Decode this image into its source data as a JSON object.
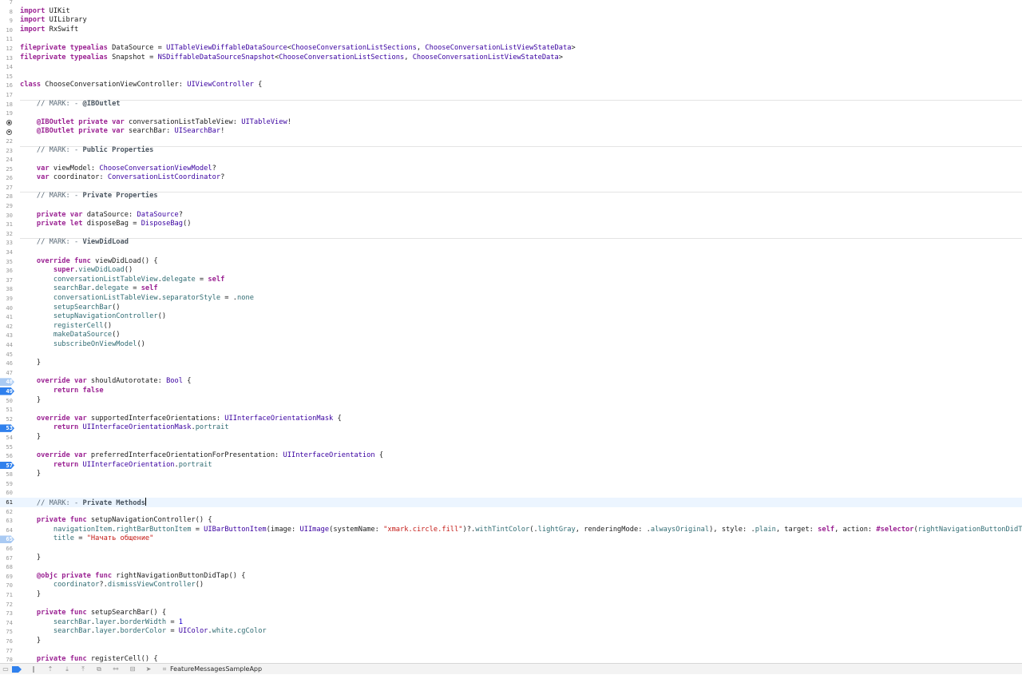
{
  "editor": {
    "current_line": 61,
    "lines": [
      {
        "n": 7,
        "t": []
      },
      {
        "n": 8,
        "t": [
          [
            "kw",
            "import"
          ],
          [
            "pl",
            " UIKit"
          ]
        ]
      },
      {
        "n": 9,
        "t": [
          [
            "kw",
            "import"
          ],
          [
            "pl",
            " UILibrary"
          ]
        ]
      },
      {
        "n": 10,
        "t": [
          [
            "kw",
            "import"
          ],
          [
            "pl",
            " RxSwift"
          ]
        ]
      },
      {
        "n": 11,
        "t": []
      },
      {
        "n": 12,
        "t": [
          [
            "kw",
            "fileprivate typealias"
          ],
          [
            "pl",
            " DataSource = "
          ],
          [
            "ty",
            "UITableViewDiffableDataSource"
          ],
          [
            "pl",
            "<"
          ],
          [
            "ty",
            "ChooseConversationListSections"
          ],
          [
            "pl",
            ", "
          ],
          [
            "ty",
            "ChooseConversationListViewStateData"
          ],
          [
            "pl",
            ">"
          ]
        ]
      },
      {
        "n": 13,
        "t": [
          [
            "kw",
            "fileprivate typealias"
          ],
          [
            "pl",
            " Snapshot = "
          ],
          [
            "ty",
            "NSDiffableDataSourceSnapshot"
          ],
          [
            "pl",
            "<"
          ],
          [
            "ty",
            "ChooseConversationListSections"
          ],
          [
            "pl",
            ", "
          ],
          [
            "ty",
            "ChooseConversationListViewStateData"
          ],
          [
            "pl",
            ">"
          ]
        ]
      },
      {
        "n": 14,
        "t": []
      },
      {
        "n": 15,
        "t": []
      },
      {
        "n": 16,
        "t": [
          [
            "kw",
            "class"
          ],
          [
            "pl",
            " ChooseConversationViewController: "
          ],
          [
            "ty",
            "UIViewController"
          ],
          [
            "pl",
            " {"
          ]
        ]
      },
      {
        "n": 17,
        "t": []
      },
      {
        "n": 18,
        "mark": true,
        "t": [
          [
            "pl",
            "    "
          ],
          [
            "cm",
            "// MARK: - "
          ],
          [
            "cmb",
            "@IBOutlet"
          ]
        ]
      },
      {
        "n": 19,
        "t": []
      },
      {
        "n": 20,
        "outlet": true,
        "t": [
          [
            "pl",
            "    "
          ],
          [
            "kw",
            "@IBOutlet private var"
          ],
          [
            "pl",
            " conversationListTableView: "
          ],
          [
            "ty",
            "UITableView"
          ],
          [
            "pl",
            "!"
          ]
        ]
      },
      {
        "n": 21,
        "outlet": true,
        "t": [
          [
            "pl",
            "    "
          ],
          [
            "kw",
            "@IBOutlet private var"
          ],
          [
            "pl",
            " searchBar: "
          ],
          [
            "ty",
            "UISearchBar"
          ],
          [
            "pl",
            "!"
          ]
        ]
      },
      {
        "n": 22,
        "t": []
      },
      {
        "n": 23,
        "mark": true,
        "t": [
          [
            "pl",
            "    "
          ],
          [
            "cm",
            "// MARK: - "
          ],
          [
            "cmb",
            "Public Properties"
          ]
        ]
      },
      {
        "n": 24,
        "t": []
      },
      {
        "n": 25,
        "t": [
          [
            "pl",
            "    "
          ],
          [
            "kw",
            "var"
          ],
          [
            "pl",
            " viewModel: "
          ],
          [
            "ty",
            "ChooseConversationViewModel"
          ],
          [
            "pl",
            "?"
          ]
        ]
      },
      {
        "n": 26,
        "t": [
          [
            "pl",
            "    "
          ],
          [
            "kw",
            "var"
          ],
          [
            "pl",
            " coordinator: "
          ],
          [
            "ty",
            "ConversationListCoordinator"
          ],
          [
            "pl",
            "?"
          ]
        ]
      },
      {
        "n": 27,
        "t": []
      },
      {
        "n": 28,
        "mark": true,
        "t": [
          [
            "pl",
            "    "
          ],
          [
            "cm",
            "// MARK: - "
          ],
          [
            "cmb",
            "Private Properties"
          ]
        ]
      },
      {
        "n": 29,
        "t": []
      },
      {
        "n": 30,
        "t": [
          [
            "pl",
            "    "
          ],
          [
            "kw",
            "private var"
          ],
          [
            "pl",
            " dataSource: "
          ],
          [
            "ty",
            "DataSource"
          ],
          [
            "pl",
            "?"
          ]
        ]
      },
      {
        "n": 31,
        "t": [
          [
            "pl",
            "    "
          ],
          [
            "kw",
            "private let"
          ],
          [
            "pl",
            " disposeBag = "
          ],
          [
            "ty",
            "DisposeBag"
          ],
          [
            "pl",
            "()"
          ]
        ]
      },
      {
        "n": 32,
        "t": []
      },
      {
        "n": 33,
        "mark": true,
        "t": [
          [
            "pl",
            "    "
          ],
          [
            "cm",
            "// MARK: - "
          ],
          [
            "cmb",
            "ViewDidLoad"
          ]
        ]
      },
      {
        "n": 34,
        "t": []
      },
      {
        "n": 35,
        "t": [
          [
            "pl",
            "    "
          ],
          [
            "kw",
            "override func"
          ],
          [
            "pl",
            " viewDidLoad() {"
          ]
        ]
      },
      {
        "n": 36,
        "t": [
          [
            "pl",
            "        "
          ],
          [
            "kw",
            "super"
          ],
          [
            "pl",
            "."
          ],
          [
            "fn",
            "viewDidLoad"
          ],
          [
            "pl",
            "()"
          ]
        ]
      },
      {
        "n": 37,
        "t": [
          [
            "pl",
            "        "
          ],
          [
            "fn",
            "conversationListTableView"
          ],
          [
            "pl",
            "."
          ],
          [
            "fn",
            "delegate"
          ],
          [
            "pl",
            " = "
          ],
          [
            "kw",
            "self"
          ]
        ]
      },
      {
        "n": 38,
        "t": [
          [
            "pl",
            "        "
          ],
          [
            "fn",
            "searchBar"
          ],
          [
            "pl",
            "."
          ],
          [
            "fn",
            "delegate"
          ],
          [
            "pl",
            " = "
          ],
          [
            "kw",
            "self"
          ]
        ]
      },
      {
        "n": 39,
        "t": [
          [
            "pl",
            "        "
          ],
          [
            "fn",
            "conversationListTableView"
          ],
          [
            "pl",
            "."
          ],
          [
            "fn",
            "separatorStyle"
          ],
          [
            "pl",
            " = ."
          ],
          [
            "fn",
            "none"
          ]
        ]
      },
      {
        "n": 40,
        "t": [
          [
            "pl",
            "        "
          ],
          [
            "fn",
            "setupSearchBar"
          ],
          [
            "pl",
            "()"
          ]
        ]
      },
      {
        "n": 41,
        "t": [
          [
            "pl",
            "        "
          ],
          [
            "fn",
            "setupNavigationController"
          ],
          [
            "pl",
            "()"
          ]
        ]
      },
      {
        "n": 42,
        "t": [
          [
            "pl",
            "        "
          ],
          [
            "fn",
            "registerCell"
          ],
          [
            "pl",
            "()"
          ]
        ]
      },
      {
        "n": 43,
        "t": [
          [
            "pl",
            "        "
          ],
          [
            "fn",
            "makeDataSource"
          ],
          [
            "pl",
            "()"
          ]
        ]
      },
      {
        "n": 44,
        "t": [
          [
            "pl",
            "        "
          ],
          [
            "fn",
            "subscribeOnViewModel"
          ],
          [
            "pl",
            "()"
          ]
        ]
      },
      {
        "n": 45,
        "t": []
      },
      {
        "n": 46,
        "t": [
          [
            "pl",
            "    }"
          ]
        ]
      },
      {
        "n": 47,
        "t": []
      },
      {
        "n": 48,
        "bp": "disabled",
        "t": [
          [
            "pl",
            "    "
          ],
          [
            "kw",
            "override var"
          ],
          [
            "pl",
            " shouldAutorotate: "
          ],
          [
            "ty",
            "Bool"
          ],
          [
            "pl",
            " {"
          ]
        ]
      },
      {
        "n": 49,
        "bp": "active",
        "t": [
          [
            "pl",
            "        "
          ],
          [
            "kw",
            "return false"
          ]
        ]
      },
      {
        "n": 50,
        "t": [
          [
            "pl",
            "    }"
          ]
        ]
      },
      {
        "n": 51,
        "t": []
      },
      {
        "n": 52,
        "t": [
          [
            "pl",
            "    "
          ],
          [
            "kw",
            "override var"
          ],
          [
            "pl",
            " supportedInterfaceOrientations: "
          ],
          [
            "ty",
            "UIInterfaceOrientationMask"
          ],
          [
            "pl",
            " {"
          ]
        ]
      },
      {
        "n": 53,
        "bp": "active",
        "t": [
          [
            "pl",
            "        "
          ],
          [
            "kw",
            "return"
          ],
          [
            "pl",
            " "
          ],
          [
            "ty",
            "UIInterfaceOrientationMask"
          ],
          [
            "pl",
            "."
          ],
          [
            "fn",
            "portrait"
          ]
        ]
      },
      {
        "n": 54,
        "t": [
          [
            "pl",
            "    }"
          ]
        ]
      },
      {
        "n": 55,
        "t": []
      },
      {
        "n": 56,
        "t": [
          [
            "pl",
            "    "
          ],
          [
            "kw",
            "override var"
          ],
          [
            "pl",
            " preferredInterfaceOrientationForPresentation: "
          ],
          [
            "ty",
            "UIInterfaceOrientation"
          ],
          [
            "pl",
            " {"
          ]
        ]
      },
      {
        "n": 57,
        "bp": "active",
        "t": [
          [
            "pl",
            "        "
          ],
          [
            "kw",
            "return"
          ],
          [
            "pl",
            " "
          ],
          [
            "ty",
            "UIInterfaceOrientation"
          ],
          [
            "pl",
            "."
          ],
          [
            "fn",
            "portrait"
          ]
        ]
      },
      {
        "n": 58,
        "t": [
          [
            "pl",
            "    }"
          ]
        ]
      },
      {
        "n": 59,
        "t": []
      },
      {
        "n": 60,
        "t": []
      },
      {
        "n": 61,
        "caret": true,
        "t": [
          [
            "pl",
            "    "
          ],
          [
            "cm",
            "// MARK: - "
          ],
          [
            "cmb",
            "Private Methods"
          ]
        ]
      },
      {
        "n": 62,
        "t": []
      },
      {
        "n": 63,
        "t": [
          [
            "pl",
            "    "
          ],
          [
            "kw",
            "private func"
          ],
          [
            "pl",
            " setupNavigationController() {"
          ]
        ]
      },
      {
        "n": 64,
        "t": [
          [
            "pl",
            "        "
          ],
          [
            "fn",
            "navigationItem"
          ],
          [
            "pl",
            "."
          ],
          [
            "fn",
            "rightBarButtonItem"
          ],
          [
            "pl",
            " = "
          ],
          [
            "ty",
            "UIBarButtonItem"
          ],
          [
            "pl",
            "(image: "
          ],
          [
            "ty",
            "UIImage"
          ],
          [
            "pl",
            "(systemName: "
          ],
          [
            "st",
            "\"xmark.circle.fill\""
          ],
          [
            "pl",
            ")?."
          ],
          [
            "fn",
            "withTintColor"
          ],
          [
            "pl",
            "(."
          ],
          [
            "fn",
            "lightGray"
          ],
          [
            "pl",
            ", renderingMode: ."
          ],
          [
            "fn",
            "alwaysOriginal"
          ],
          [
            "pl",
            "), style: ."
          ],
          [
            "fn",
            "plain"
          ],
          [
            "pl",
            ", target: "
          ],
          [
            "kw",
            "self"
          ],
          [
            "pl",
            ", action: "
          ],
          [
            "kw",
            "#selector"
          ],
          [
            "pl",
            "("
          ],
          [
            "fn",
            "rightNavigationButtonDidTap"
          ],
          [
            "pl",
            "))"
          ]
        ]
      },
      {
        "n": 65,
        "bp": "disabled",
        "t": [
          [
            "pl",
            "        "
          ],
          [
            "fn",
            "title"
          ],
          [
            "pl",
            " = "
          ],
          [
            "st",
            "\"Начать общение\""
          ]
        ]
      },
      {
        "n": 66,
        "t": []
      },
      {
        "n": 67,
        "t": [
          [
            "pl",
            "    }"
          ]
        ]
      },
      {
        "n": 68,
        "t": []
      },
      {
        "n": 69,
        "t": [
          [
            "pl",
            "    "
          ],
          [
            "kw",
            "@objc private func"
          ],
          [
            "pl",
            " rightNavigationButtonDidTap() {"
          ]
        ]
      },
      {
        "n": 70,
        "t": [
          [
            "pl",
            "        "
          ],
          [
            "fn",
            "coordinator"
          ],
          [
            "pl",
            "?."
          ],
          [
            "fn",
            "dismissViewController"
          ],
          [
            "pl",
            "()"
          ]
        ]
      },
      {
        "n": 71,
        "t": [
          [
            "pl",
            "    }"
          ]
        ]
      },
      {
        "n": 72,
        "t": []
      },
      {
        "n": 73,
        "t": [
          [
            "pl",
            "    "
          ],
          [
            "kw",
            "private func"
          ],
          [
            "pl",
            " setupSearchBar() {"
          ]
        ]
      },
      {
        "n": 74,
        "t": [
          [
            "pl",
            "        "
          ],
          [
            "fn",
            "searchBar"
          ],
          [
            "pl",
            "."
          ],
          [
            "fn",
            "layer"
          ],
          [
            "pl",
            "."
          ],
          [
            "fn",
            "borderWidth"
          ],
          [
            "pl",
            " = "
          ],
          [
            "nu",
            "1"
          ]
        ]
      },
      {
        "n": 75,
        "t": [
          [
            "pl",
            "        "
          ],
          [
            "fn",
            "searchBar"
          ],
          [
            "pl",
            "."
          ],
          [
            "fn",
            "layer"
          ],
          [
            "pl",
            "."
          ],
          [
            "fn",
            "borderColor"
          ],
          [
            "pl",
            " = "
          ],
          [
            "ty",
            "UIColor"
          ],
          [
            "pl",
            "."
          ],
          [
            "fn",
            "white"
          ],
          [
            "pl",
            "."
          ],
          [
            "fn",
            "cgColor"
          ]
        ]
      },
      {
        "n": 76,
        "t": [
          [
            "pl",
            "    }"
          ]
        ]
      },
      {
        "n": 77,
        "t": []
      },
      {
        "n": 78,
        "t": [
          [
            "pl",
            "    "
          ],
          [
            "kw",
            "private func"
          ],
          [
            "pl",
            " registerCell() {"
          ]
        ]
      }
    ]
  },
  "debug_bar": {
    "icons": [
      "hide-debug-area-icon",
      "breakpoints-toggle-icon",
      "pause-continue-icon",
      "step-over-icon",
      "step-into-icon",
      "step-out-icon",
      "view-hierarchy-icon",
      "memory-graph-icon",
      "environment-overrides-icon",
      "simulate-location-icon",
      "scheme-target-icon"
    ],
    "target_label": "FeatureMessagesSampleApp"
  }
}
